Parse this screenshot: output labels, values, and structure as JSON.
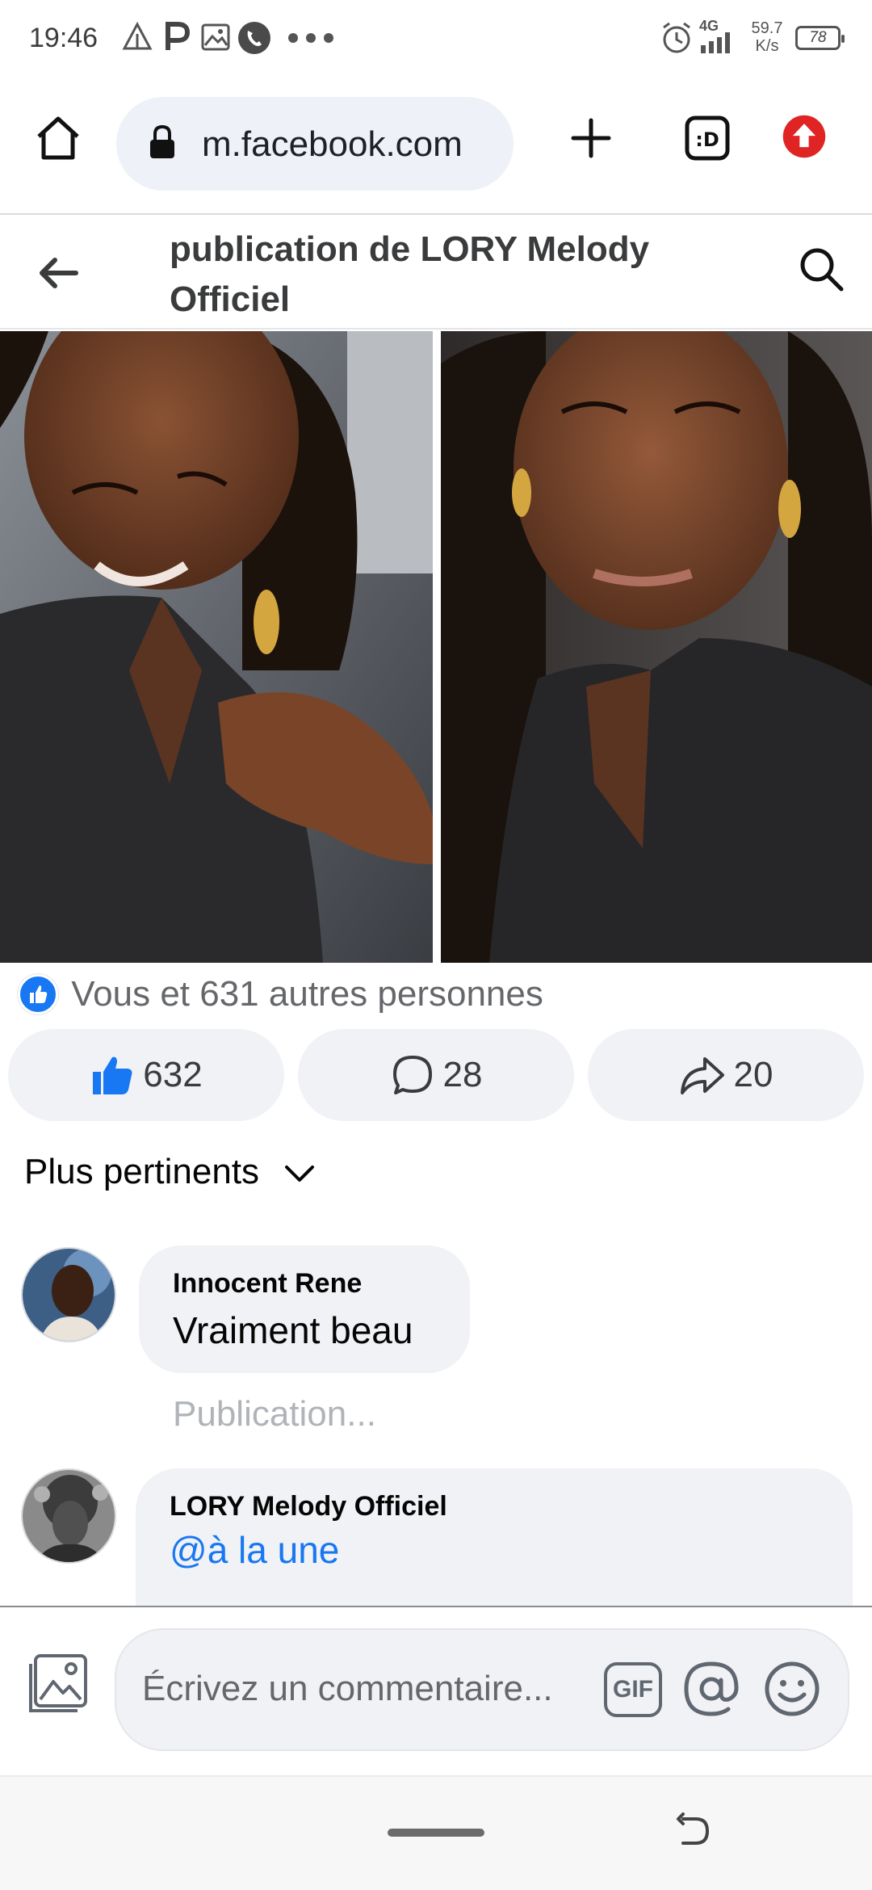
{
  "status_bar": {
    "time": "19:46",
    "network_label": "4G",
    "speed_value": "59.7",
    "speed_unit": "K/s",
    "battery": "78"
  },
  "browser": {
    "url": "m.facebook.com"
  },
  "header": {
    "title": "publication de LORY Melody Officiel"
  },
  "post": {
    "reactions_summary": "Vous et 631 autres personnes",
    "like_count": "632",
    "comment_count": "28",
    "share_count": "20"
  },
  "sort": {
    "label": "Plus pertinents"
  },
  "comments": [
    {
      "author": "Innocent Rene",
      "text": "Vraiment beau",
      "sub": "Publication..."
    },
    {
      "author": "LORY Melody Officiel",
      "text": "@à la une"
    }
  ],
  "composer": {
    "placeholder": "Écrivez un commentaire...",
    "gif_label": "GIF"
  },
  "colors": {
    "facebook_blue": "#1877f2",
    "pill_gray": "#f0f2f5",
    "upload_red": "#e02424"
  }
}
